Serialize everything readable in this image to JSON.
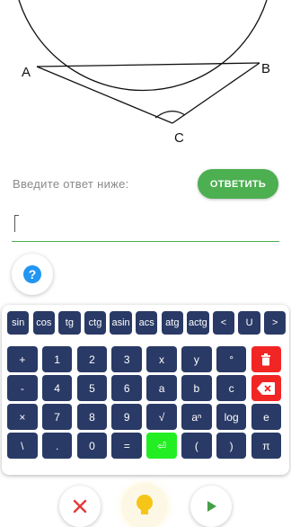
{
  "figure": {
    "labels": {
      "a": "A",
      "b": "B",
      "c": "C"
    }
  },
  "prompt": "Введите ответ ниже:",
  "answer_button": "ОТВЕТИТЬ",
  "answer_input": {
    "value": ""
  },
  "help_button": {
    "icon": "question-icon",
    "glyph": "?"
  },
  "keyboard": {
    "rows": [
      [
        {
          "label": "sin"
        },
        {
          "label": "cos"
        },
        {
          "label": "tg"
        },
        {
          "label": "ctg"
        },
        {
          "label": "asin"
        },
        {
          "label": "acs"
        },
        {
          "label": "atg"
        },
        {
          "label": "actg"
        },
        {
          "label": "<"
        },
        {
          "label": "U"
        },
        {
          "label": ">"
        }
      ],
      [
        {
          "label": "+"
        },
        {
          "label": "1"
        },
        {
          "label": "2"
        },
        {
          "label": "3"
        },
        {
          "label": "x"
        },
        {
          "label": "y"
        },
        {
          "label": "°"
        },
        {
          "label": "",
          "icon": "trash-icon",
          "color": "red"
        }
      ],
      [
        {
          "label": "-"
        },
        {
          "label": "4"
        },
        {
          "label": "5"
        },
        {
          "label": "6"
        },
        {
          "label": "a"
        },
        {
          "label": "b"
        },
        {
          "label": "c"
        },
        {
          "label": "",
          "icon": "backspace-icon",
          "color": "red"
        }
      ],
      [
        {
          "label": "×"
        },
        {
          "label": "7"
        },
        {
          "label": "8"
        },
        {
          "label": "9"
        },
        {
          "label": "√"
        },
        {
          "label": "aⁿ"
        },
        {
          "label": "log"
        },
        {
          "label": "e"
        }
      ],
      [
        {
          "label": "\\"
        },
        {
          "label": "."
        },
        {
          "label": "0"
        },
        {
          "label": "="
        },
        {
          "label": "⏎",
          "icon": "enter-icon",
          "color": "green"
        },
        {
          "label": "("
        },
        {
          "label": ")"
        },
        {
          "label": "π"
        }
      ]
    ],
    "colors": {
      "key": "#2a3a66",
      "red": "#f22525",
      "green": "#22ee22"
    }
  },
  "bottom_actions": [
    {
      "name": "close",
      "icon": "close-icon",
      "color": "#e53935"
    },
    {
      "name": "hint",
      "icon": "lightbulb-icon",
      "color": "#f5c518"
    },
    {
      "name": "next",
      "icon": "play-icon",
      "color": "#43a047"
    }
  ]
}
